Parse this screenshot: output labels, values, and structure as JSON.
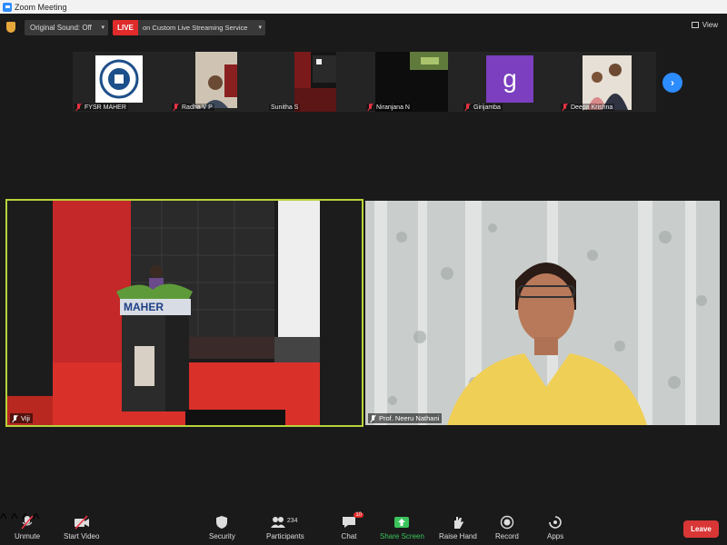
{
  "window": {
    "title": "Zoom Meeting"
  },
  "topbar": {
    "sound_label": "Original Sound: Off",
    "live_badge": "LIVE",
    "live_text": "on Custom Live Streaming Service",
    "view_label": "View"
  },
  "thumbnails": [
    {
      "name": "FYSR MAHER"
    },
    {
      "name": "Radha V P"
    },
    {
      "name": "Sunitha S"
    },
    {
      "name": "Niranjana N"
    },
    {
      "name": "Girijamba",
      "avatar_letter": "g"
    },
    {
      "name": "Deepa Krishna"
    }
  ],
  "tiles": {
    "left": {
      "name": "Viji",
      "banner": "MAHER"
    },
    "right": {
      "name": "Prof. Neeru Nathani"
    }
  },
  "toolbar": {
    "unmute": "Unmute",
    "start_video": "Start Video",
    "security": "Security",
    "participants": "Participants",
    "participants_count": "234",
    "chat": "Chat",
    "chat_badge": "10",
    "share_screen": "Share Screen",
    "raise_hand": "Raise Hand",
    "record": "Record",
    "apps": "Apps",
    "leave": "Leave"
  },
  "colors": {
    "accent_blue": "#2d8cff",
    "live_red": "#e02b2b",
    "active_speaker_border": "#b6d33a",
    "share_green": "#3cc45c",
    "leave_red": "#d93636"
  }
}
